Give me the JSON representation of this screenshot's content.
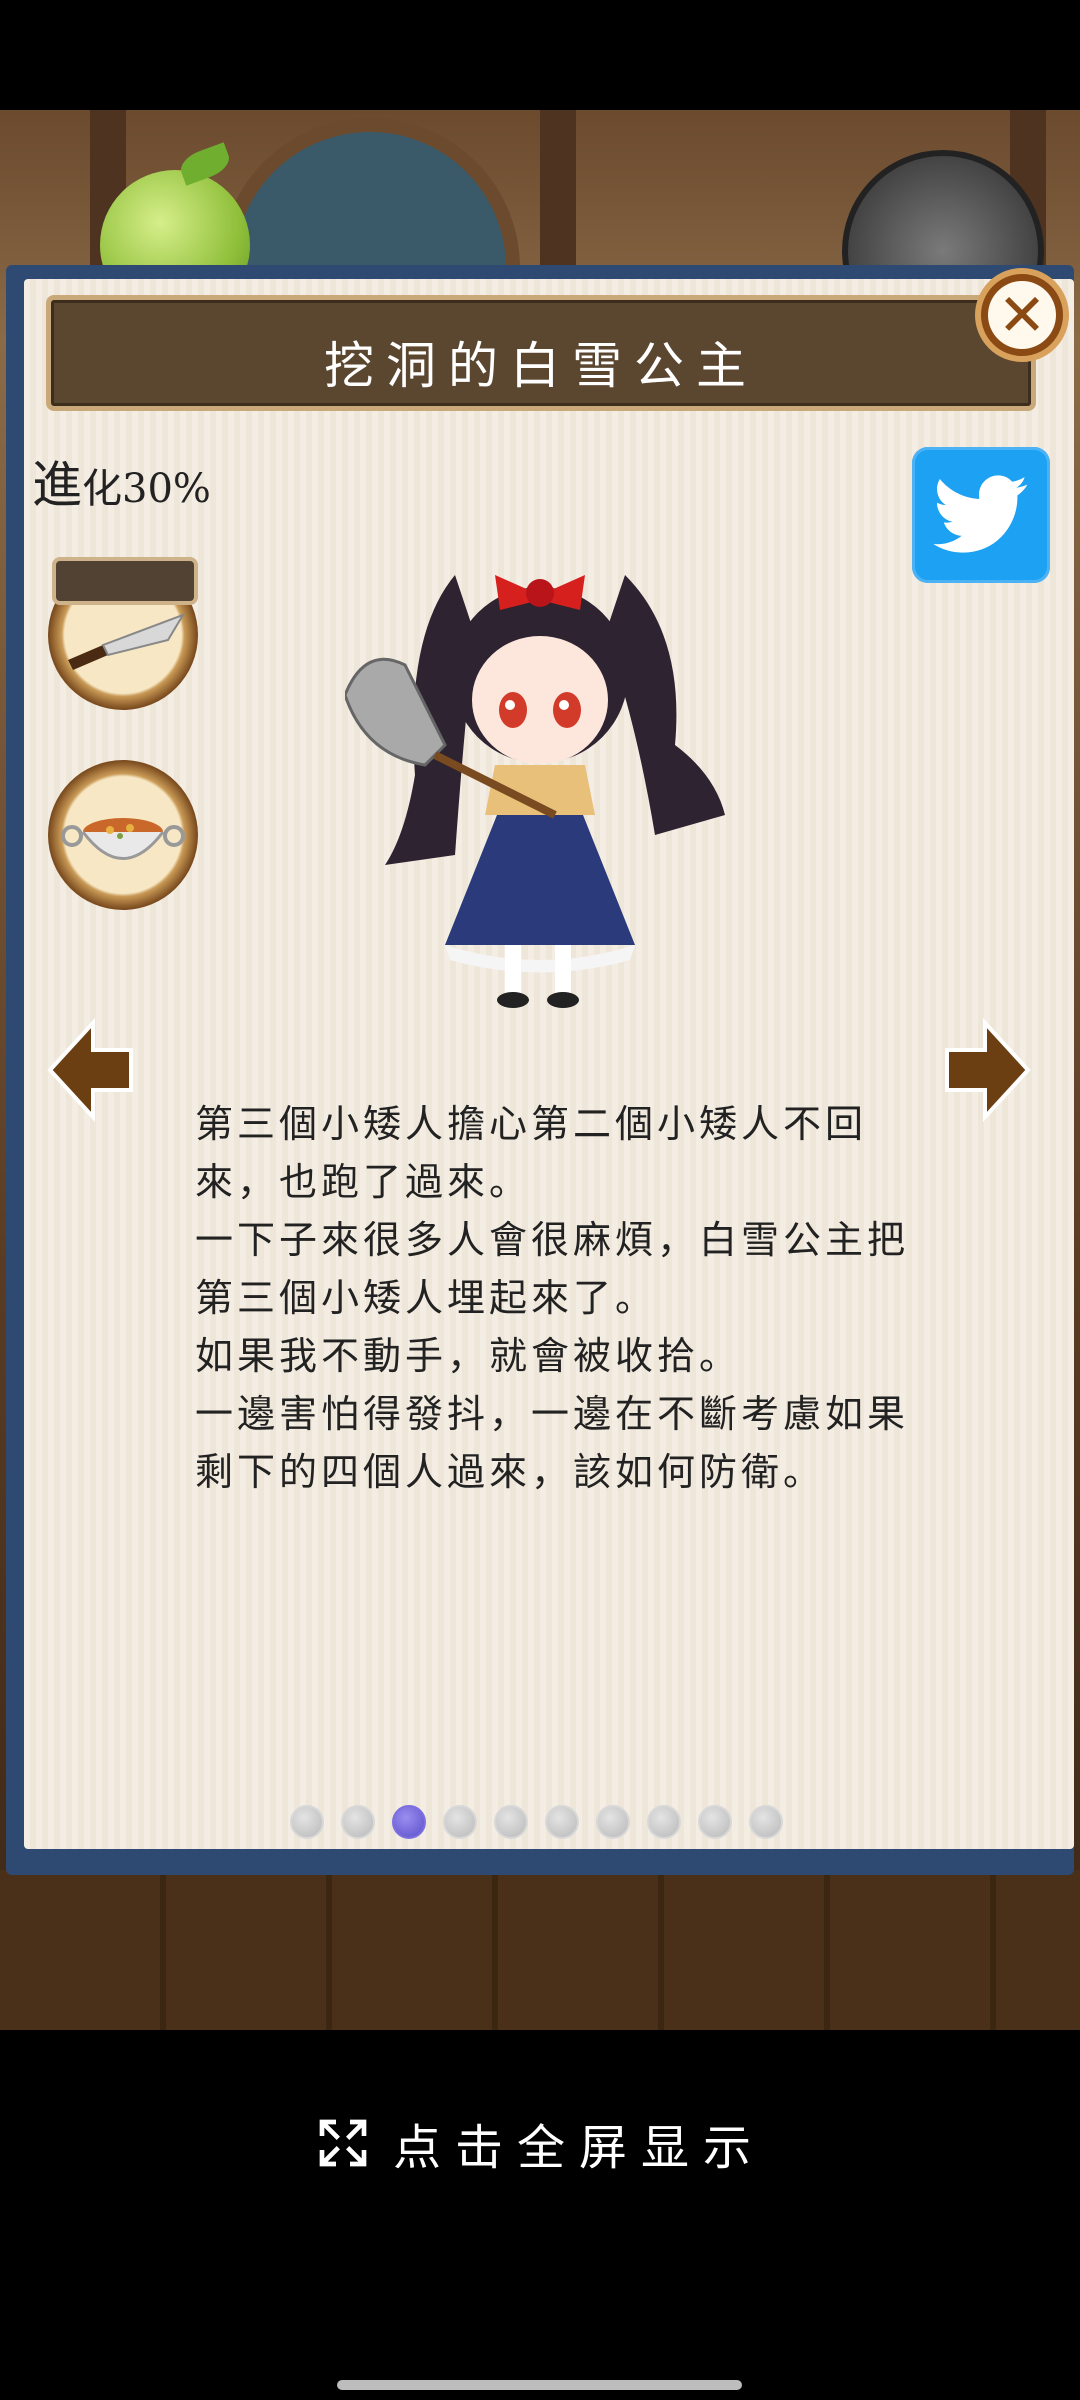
{
  "dialog": {
    "title": "挖洞的白雪公主",
    "evolution_prefix": "進",
    "evolution_text": "化30%"
  },
  "story": {
    "paragraphs": [
      "第三個小矮人擔心第二個小矮人不回來，也跑了過來。",
      "一下子來很多人會很麻煩，白雪公主把第三個小矮人埋起來了。",
      "如果我不動手，就會被收拾。",
      "一邊害怕得發抖，一邊在不斷考慮如果剩下的四個人過來，該如何防衛。"
    ]
  },
  "pagination": {
    "total": 10,
    "current_index": 2
  },
  "fullscreen": {
    "label": "点击全屏显示"
  },
  "colors": {
    "twitter": "#1da1f2",
    "title_bar": "#5b4630",
    "active_dot": "#5b4ec9",
    "arrow": "#6b3f12"
  },
  "icons": {
    "close": "close-icon",
    "twitter": "twitter-bird-icon",
    "knife": "knife-icon",
    "soup": "soup-bowl-icon",
    "prev": "arrow-left-icon",
    "next": "arrow-right-icon",
    "fullscreen": "expand-icon"
  }
}
